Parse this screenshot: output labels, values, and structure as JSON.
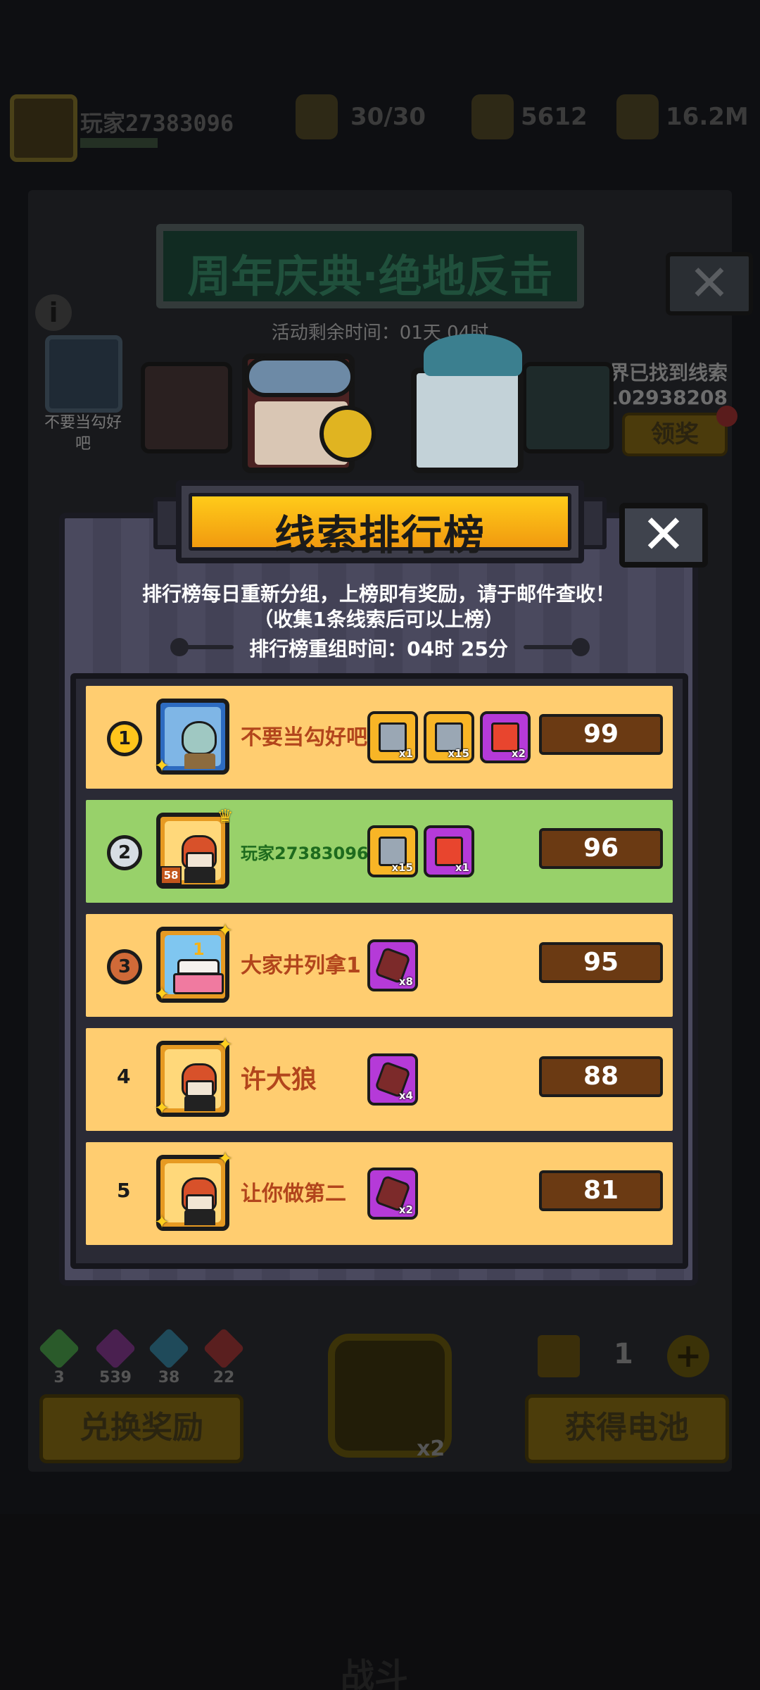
{
  "background": {
    "player_name": "玩家27383096",
    "energy": "30/30",
    "gems_top": "5612",
    "gold": "16.2M",
    "event_title": "周年庆典·绝地反击",
    "event_timer": "活动剩余时间：01天 04时",
    "left_player_name": "不要当勾好吧",
    "world_found_label": "全世界已找到线索",
    "world_found_count": "102938208",
    "claim_label": "领奖",
    "gems": [
      {
        "value": "3",
        "color": "#2a5a2a"
      },
      {
        "value": "539",
        "color": "#4a2050"
      },
      {
        "value": "38",
        "color": "#1f4a5a"
      },
      {
        "value": "22",
        "color": "#5a1f1f"
      }
    ],
    "lock_multiplier": "x2",
    "battery_count": "1",
    "plus_label": "+",
    "exchange_button": "兑换奖励",
    "get_battery_button": "获得电池",
    "nav_battle": "战斗"
  },
  "modal": {
    "title": "线索排行榜",
    "close_label": "✕",
    "desc_line1": "排行榜每日重新分组，上榜即有奖励，请于邮件查收！",
    "desc_line2": "（收集1条线索后可以上榜）",
    "reset_time": "排行榜重组时间：04时 25分"
  },
  "leaderboard": [
    {
      "rank": "1",
      "name": "不要当勾好吧",
      "score": "99",
      "avatar": "squid",
      "rewards": [
        {
          "type": "chest",
          "qty": "x1"
        },
        {
          "type": "chest",
          "qty": "x15"
        },
        {
          "type": "gift",
          "qty": "x2"
        }
      ]
    },
    {
      "rank": "2",
      "name": "玩家27383096",
      "score": "96",
      "avatar": "redhair",
      "level": "58",
      "rewards": [
        {
          "type": "chest",
          "qty": "x15"
        },
        {
          "type": "gift",
          "qty": "x1"
        }
      ]
    },
    {
      "rank": "3",
      "name": "大家井列拿1",
      "score": "95",
      "avatar": "cake",
      "rewards": [
        {
          "type": "fragment",
          "qty": "x8"
        }
      ]
    },
    {
      "rank": "4",
      "name": "许大狼",
      "score": "88",
      "avatar": "redhair",
      "rewards": [
        {
          "type": "fragment",
          "qty": "x4"
        }
      ]
    },
    {
      "rank": "5",
      "name": "让你做第二",
      "score": "81",
      "avatar": "redhair",
      "rewards": [
        {
          "type": "fragment",
          "qty": "x2"
        }
      ]
    }
  ],
  "colors": {
    "row_default": "#ffcd70",
    "row_self": "#98d16a",
    "title_gold": "#ffcb1a",
    "score_bg": "#6b3a13",
    "name_text": "#b2451c"
  }
}
